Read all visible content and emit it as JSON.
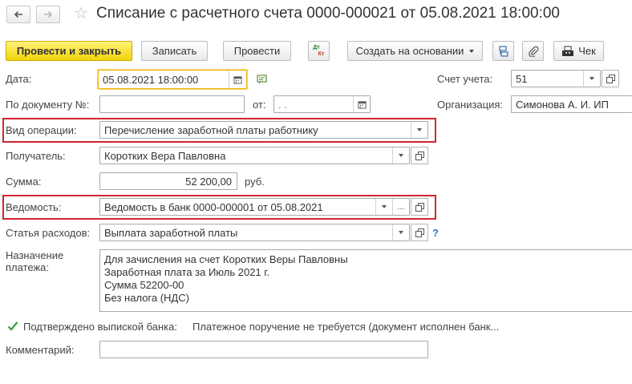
{
  "window": {
    "title": "Списание с расчетного счета 0000-000021 от 05.08.2021 18:00:00"
  },
  "toolbar": {
    "post_and_close": "Провести и закрыть",
    "save": "Записать",
    "post": "Провести",
    "dt_kt_top": "Дт",
    "dt_kt_bottom": "Кт",
    "create_based_on": "Создать на основании",
    "receipt": "Чек"
  },
  "form": {
    "date_label": "Дата:",
    "date_value": "05.08.2021 18:00:00",
    "doc_number_label": "По документу №:",
    "doc_number_value": "",
    "from_label": "от:",
    "from_value": " .  .",
    "account_label": "Счет учета:",
    "account_value": "51",
    "organization_label": "Организация:",
    "organization_value": "Симонова А. И. ИП",
    "operation_label": "Вид операции:",
    "operation_value": "Перечисление заработной платы работнику",
    "recipient_label": "Получатель:",
    "recipient_value": "Коротких Вера Павловна",
    "amount_label": "Сумма:",
    "amount_value": "52 200,00",
    "currency": "руб.",
    "statement_label": "Ведомость:",
    "statement_value": "Ведомость в банк 0000-000001 от 05.08.2021",
    "expense_label": "Статья расходов:",
    "expense_value": "Выплата заработной платы",
    "help_mark": "?",
    "purpose_label_1": "Назначение",
    "purpose_label_2": "платежа:",
    "purpose_lines": [
      "Для зачисления на счет Коротких Веры Павловны",
      "Заработная плата за Июль 2021 г.",
      "Сумма 52200-00",
      "Без налога (НДС)"
    ],
    "bank_confirmed_label": "Подтверждено выпиской банка:",
    "bank_confirmed_checked": true,
    "payment_order_text": "Платежное поручение не требуется (документ исполнен банк...",
    "comment_label": "Комментарий:",
    "comment_value": "",
    "dots": "..."
  },
  "colors": {
    "primary_button": "#f2d40a",
    "highlight_border": "#d0262e",
    "focus_border": "#f0b400",
    "check_mark": "#3a9b3a",
    "help_link": "#2a7bd3"
  }
}
